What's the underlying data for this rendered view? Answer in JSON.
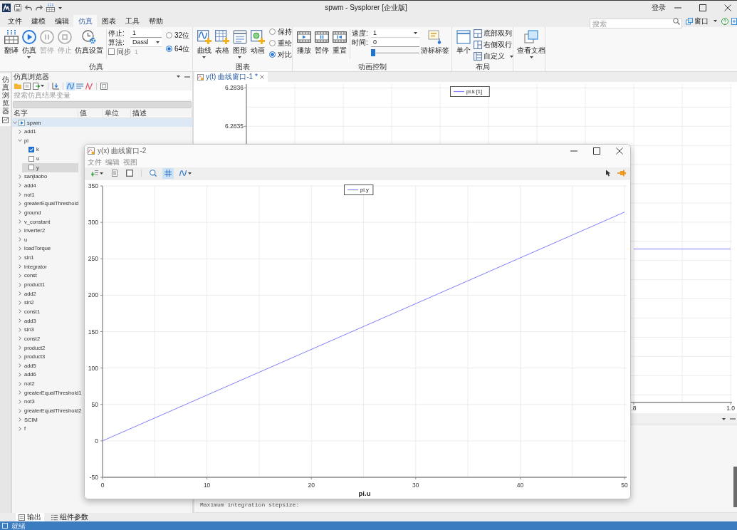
{
  "title_bar": {
    "title": "spwm - Sysplorer [企业版]",
    "login": "登录"
  },
  "menu_tabs": [
    {
      "label": "文件",
      "selected": false
    },
    {
      "label": "建模",
      "selected": false
    },
    {
      "label": "编辑",
      "selected": false
    },
    {
      "label": "仿真",
      "selected": true
    },
    {
      "label": "图表",
      "selected": false
    },
    {
      "label": "工具",
      "selected": false
    },
    {
      "label": "帮助",
      "selected": false
    }
  ],
  "search": {
    "placeholder": "搜索"
  },
  "window_menu": {
    "label": "窗口"
  },
  "ribbon": [
    {
      "label": "仿真",
      "items": [
        {
          "kind": "button",
          "label": "翻译",
          "disabled": false,
          "dropdown": false
        },
        {
          "kind": "button",
          "label": "仿真",
          "disabled": false,
          "dropdown": true
        },
        {
          "kind": "button",
          "label": "暂停",
          "disabled": true,
          "dropdown": false
        },
        {
          "kind": "button",
          "label": "停止",
          "disabled": true,
          "dropdown": false
        },
        {
          "kind": "button",
          "label": "仿真设置",
          "disabled": false,
          "dropdown": false
        },
        {
          "kind": "fields",
          "rows": [
            {
              "kind": "input",
              "label": "停止:",
              "value": "1"
            },
            {
              "kind": "select",
              "label": "算法:",
              "value": "Dassl"
            },
            {
              "kind": "checkbox",
              "label": "同步",
              "checked": false,
              "value": "1"
            }
          ]
        },
        {
          "kind": "radios",
          "options": [
            {
              "label": "32位",
              "selected": false
            },
            {
              "label": "64位",
              "selected": true
            }
          ]
        }
      ]
    },
    {
      "label": "图表",
      "items": [
        {
          "kind": "button",
          "label": "曲线",
          "disabled": false,
          "dropdown": true
        },
        {
          "kind": "button",
          "label": "表格",
          "disabled": false,
          "dropdown": false
        },
        {
          "kind": "button",
          "label": "图形",
          "disabled": false,
          "dropdown": true
        },
        {
          "kind": "button",
          "label": "动画",
          "disabled": false,
          "dropdown": false
        },
        {
          "kind": "radios",
          "options": [
            {
              "label": "保持",
              "selected": false
            },
            {
              "label": "重绘",
              "selected": false
            },
            {
              "label": "对比",
              "selected": true
            }
          ]
        }
      ]
    },
    {
      "label": "动画控制",
      "items": [
        {
          "kind": "button",
          "label": "播放",
          "disabled": false,
          "dropdown": false
        },
        {
          "kind": "button",
          "label": "暂停",
          "disabled": false,
          "dropdown": false
        },
        {
          "kind": "button",
          "label": "重置",
          "disabled": false,
          "dropdown": false
        },
        {
          "kind": "fields",
          "rows": [
            {
              "kind": "select",
              "label": "速度:",
              "value": "1"
            },
            {
              "kind": "input",
              "label": "时间:",
              "value": "0"
            },
            {
              "kind": "slider",
              "level": 0
            }
          ]
        },
        {
          "kind": "button",
          "label": "游标标签",
          "disabled": false,
          "dropdown": false
        }
      ]
    },
    {
      "label": "布局",
      "items": [
        {
          "kind": "button",
          "label": "单个",
          "disabled": false,
          "dropdown": false
        },
        {
          "kind": "small_buttons",
          "buttons": [
            {
              "label": "底部双列",
              "dropdown": false
            },
            {
              "label": "右侧双行",
              "dropdown": false
            },
            {
              "label": "自定义",
              "dropdown": true
            }
          ]
        }
      ]
    },
    {
      "items": [
        {
          "kind": "button",
          "label": "查看文档",
          "disabled": false,
          "dropdown": true
        }
      ]
    }
  ],
  "side_strip": {
    "label": "仿真浏览器"
  },
  "browser": {
    "title": "仿真浏览器",
    "toolbar": [
      [
        {
          "active": false,
          "dropdown": false
        },
        {
          "active": false,
          "dropdown": false
        },
        {
          "active": false,
          "dropdown": true
        }
      ],
      [
        {
          "active": false,
          "dropdown": false
        }
      ],
      [
        {
          "active": true,
          "dropdown": false
        },
        {
          "active": false,
          "dropdown": false
        },
        {
          "active": false,
          "dropdown": false
        }
      ],
      [
        {
          "active": false,
          "dropdown": false
        }
      ]
    ],
    "search": {
      "placeholder": "搜索仿真结果变量"
    },
    "columns": [
      "名字",
      "值",
      "单位",
      "描述"
    ],
    "tree": [
      {
        "name": "spwm",
        "kind": "model",
        "expanded": true,
        "selected": true,
        "highlighted": false,
        "children": [
          {
            "name": "add1",
            "kind": "component",
            "expanded": false,
            "selected": false,
            "highlighted": false
          },
          {
            "name": "pi",
            "kind": "component",
            "expanded": true,
            "selected": false,
            "highlighted": false,
            "children": [
              {
                "name": "k",
                "kind": "variable",
                "checked": true,
                "selected": false,
                "highlighted": false
              },
              {
                "name": "u",
                "kind": "variable",
                "checked": false,
                "selected": false,
                "highlighted": false
              },
              {
                "name": "y",
                "kind": "variable",
                "checked": false,
                "selected": false,
                "highlighted": true
              }
            ]
          },
          {
            "name": "sanjiaobo",
            "kind": "component",
            "expanded": false,
            "selected": false,
            "highlighted": false
          },
          {
            "name": "add4",
            "kind": "component",
            "expanded": false,
            "selected": false,
            "highlighted": false
          },
          {
            "name": "not1",
            "kind": "component",
            "expanded": false,
            "selected": false,
            "highlighted": false
          },
          {
            "name": "greaterEqualThreshold",
            "kind": "component",
            "expanded": false,
            "selected": false,
            "highlighted": false
          },
          {
            "name": "ground",
            "kind": "component",
            "expanded": false,
            "selected": false,
            "highlighted": false
          },
          {
            "name": "v_constant",
            "kind": "component",
            "expanded": false,
            "selected": false,
            "highlighted": false
          },
          {
            "name": "inverter2",
            "kind": "component",
            "expanded": false,
            "selected": false,
            "highlighted": false
          },
          {
            "name": "u",
            "kind": "component",
            "expanded": false,
            "selected": false,
            "highlighted": false
          },
          {
            "name": "loadTorque",
            "kind": "component",
            "expanded": false,
            "selected": false,
            "highlighted": false
          },
          {
            "name": "sin1",
            "kind": "component",
            "expanded": false,
            "selected": false,
            "highlighted": false
          },
          {
            "name": "integrator",
            "kind": "component",
            "expanded": false,
            "selected": false,
            "highlighted": false
          },
          {
            "name": "const",
            "kind": "component",
            "expanded": false,
            "selected": false,
            "highlighted": false
          },
          {
            "name": "product1",
            "kind": "component",
            "expanded": false,
            "selected": false,
            "highlighted": false
          },
          {
            "name": "add2",
            "kind": "component",
            "expanded": false,
            "selected": false,
            "highlighted": false
          },
          {
            "name": "sin2",
            "kind": "component",
            "expanded": false,
            "selected": false,
            "highlighted": false
          },
          {
            "name": "const1",
            "kind": "component",
            "expanded": false,
            "selected": false,
            "highlighted": false
          },
          {
            "name": "add3",
            "kind": "component",
            "expanded": false,
            "selected": false,
            "highlighted": false
          },
          {
            "name": "sin3",
            "kind": "component",
            "expanded": false,
            "selected": false,
            "highlighted": false
          },
          {
            "name": "const2",
            "kind": "component",
            "expanded": false,
            "selected": false,
            "highlighted": false
          },
          {
            "name": "product2",
            "kind": "component",
            "expanded": false,
            "selected": false,
            "highlighted": false
          },
          {
            "name": "product3",
            "kind": "component",
            "expanded": false,
            "selected": false,
            "highlighted": false
          },
          {
            "name": "add5",
            "kind": "component",
            "expanded": false,
            "selected": false,
            "highlighted": false
          },
          {
            "name": "add6",
            "kind": "component",
            "expanded": false,
            "selected": false,
            "highlighted": false
          },
          {
            "name": "not2",
            "kind": "component",
            "expanded": false,
            "selected": false,
            "highlighted": false
          },
          {
            "name": "greaterEqualThreshold1",
            "kind": "component",
            "expanded": false,
            "selected": false,
            "highlighted": false
          },
          {
            "name": "not3",
            "kind": "component",
            "expanded": false,
            "selected": false,
            "highlighted": false
          },
          {
            "name": "greaterEqualThreshold2",
            "kind": "component",
            "expanded": false,
            "selected": false,
            "highlighted": false
          },
          {
            "name": "SCIM",
            "kind": "component",
            "expanded": false,
            "selected": false,
            "highlighted": false
          },
          {
            "name": "f",
            "kind": "component",
            "expanded": false,
            "selected": false,
            "highlighted": false
          }
        ]
      }
    ]
  },
  "document_tabs": [
    {
      "label": "y(t) 曲线窗口-1 *",
      "selected": true
    }
  ],
  "plot": {
    "chart_data": {
      "type": "line",
      "x": [
        0.8,
        1.0
      ],
      "series": [
        {
          "name": "pi.k [1]",
          "color": "#7f7fff",
          "values": [
            6.28318,
            6.28318
          ]
        }
      ],
      "xlim": [
        0,
        1
      ],
      "ylim": [
        6.28278,
        6.28361
      ],
      "xticks": [
        {
          "value": 0.8,
          "label": ".8"
        },
        {
          "value": 1,
          "label": "1.0"
        }
      ],
      "yticks": [
        6.2836,
        6.2835
      ],
      "grid": true
    }
  },
  "output": {
    "text": "Maximum integration stepsize:"
  },
  "bottom_tabs": [
    {
      "label": "输出",
      "selected": true
    },
    {
      "label": "组件参数",
      "selected": false
    }
  ],
  "status_bar": {
    "text": "就绪"
  },
  "plot_window": {
    "title": "y(x) 曲线窗口-2",
    "menu": [
      "文件",
      "编辑",
      "视图"
    ],
    "toolbar": [
      [
        {
          "active": false,
          "dropdown": true
        },
        {
          "active": false,
          "dropdown": false
        },
        {
          "active": false,
          "dropdown": false
        }
      ],
      [
        {
          "active": false,
          "dropdown": false
        },
        {
          "active": true,
          "dropdown": false
        },
        {
          "active": false,
          "dropdown": true
        }
      ]
    ],
    "chart_data": {
      "type": "line",
      "xlabel": "pi.u",
      "x": [
        0,
        50
      ],
      "series": [
        {
          "name": "pi.y",
          "color": "#7f7fff",
          "values": [
            0,
            314
          ]
        }
      ],
      "xlim": [
        0,
        50.2
      ],
      "ylim": [
        -50,
        350
      ],
      "xticks": [
        0,
        10,
        20,
        30,
        40,
        50
      ],
      "yticks": [
        -50,
        0,
        50,
        100,
        150,
        200,
        250,
        300,
        350
      ],
      "grid": true
    }
  }
}
